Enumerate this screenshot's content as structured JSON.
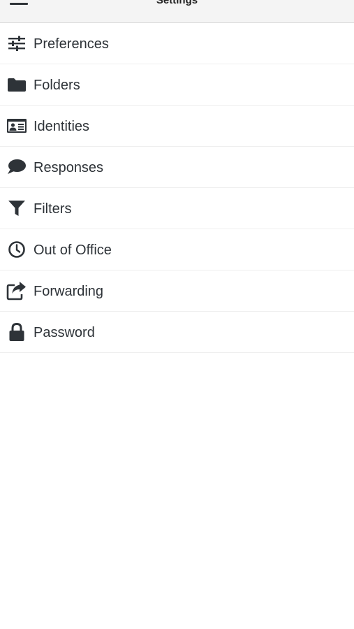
{
  "header": {
    "title": "Settings"
  },
  "settings": {
    "items": [
      {
        "label": "Preferences",
        "icon": "sliders-icon"
      },
      {
        "label": "Folders",
        "icon": "folder-icon"
      },
      {
        "label": "Identities",
        "icon": "id-card-icon"
      },
      {
        "label": "Responses",
        "icon": "comment-icon"
      },
      {
        "label": "Filters",
        "icon": "filter-icon"
      },
      {
        "label": "Out of Office",
        "icon": "clock-icon"
      },
      {
        "label": "Forwarding",
        "icon": "share-icon"
      },
      {
        "label": "Password",
        "icon": "lock-icon"
      }
    ]
  },
  "colors": {
    "text": "#2e3338",
    "header_background": "#f4f4f4",
    "divider": "#eeeeee"
  }
}
